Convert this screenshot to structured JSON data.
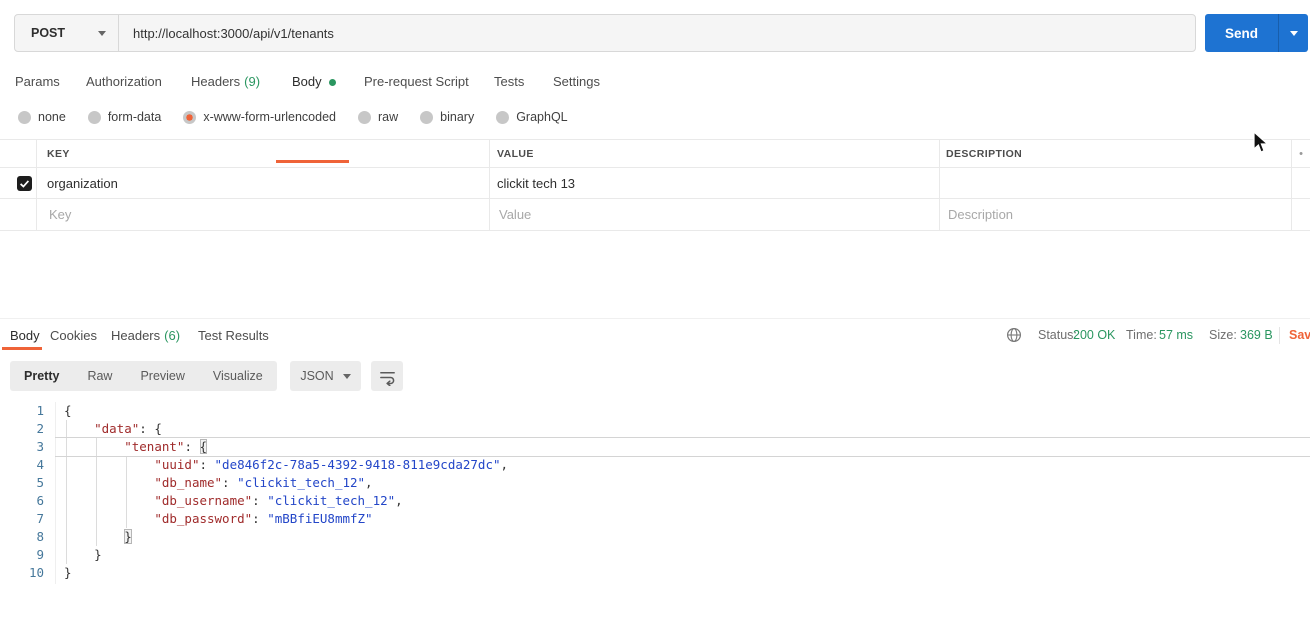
{
  "colors": {
    "accent-orange": "#ef6338",
    "send-blue": "#1e73d2",
    "success-green": "#2a9660",
    "code-key": "#a02c2c",
    "code-str": "#2346c8",
    "code-linenum": "#46789b"
  },
  "request": {
    "method": "POST",
    "url": "http://localhost:3000/api/v1/tenants",
    "send_label": "Send",
    "tabs": [
      {
        "label": "Params"
      },
      {
        "label": "Authorization"
      },
      {
        "label": "Headers",
        "count": "(9)"
      },
      {
        "label": "Body",
        "active": true
      },
      {
        "label": "Pre-request Script"
      },
      {
        "label": "Tests"
      },
      {
        "label": "Settings"
      }
    ],
    "body_modes": {
      "selected": "x-www-form-urlencoded",
      "items": [
        "none",
        "form-data",
        "x-www-form-urlencoded",
        "raw",
        "binary",
        "GraphQL"
      ]
    },
    "params_table": {
      "columns": [
        "KEY",
        "VALUE",
        "DESCRIPTION"
      ],
      "overflow_dot": "•",
      "rows": [
        {
          "checked": true,
          "key": "organization",
          "value": "clickit tech 13",
          "description": ""
        }
      ],
      "new_row": {
        "key_placeholder": "Key",
        "value_placeholder": "Value",
        "description_placeholder": "Description"
      }
    }
  },
  "response": {
    "tabs": [
      {
        "label": "Body",
        "active": true
      },
      {
        "label": "Cookies"
      },
      {
        "label": "Headers",
        "count": "(6)"
      },
      {
        "label": "Test Results"
      }
    ],
    "meta": {
      "status_label": "Status:",
      "status_value": "200 OK",
      "time_label": "Time:",
      "time_value": "57 ms",
      "size_label": "Size:",
      "size_value": "369 B",
      "save_label": "Sav"
    },
    "view_tabs": {
      "active": "Pretty",
      "items": [
        "Pretty",
        "Raw",
        "Preview",
        "Visualize"
      ]
    },
    "format": "JSON",
    "code": {
      "lines": [
        {
          "n": 1,
          "segs": [
            {
              "t": "{",
              "y": "p"
            }
          ]
        },
        {
          "n": 2,
          "segs": [
            {
              "t": "    ",
              "y": "p"
            },
            {
              "t": "\"data\"",
              "y": "k"
            },
            {
              "t": ": {",
              "y": "p"
            }
          ]
        },
        {
          "n": 3,
          "highlight": true,
          "segs": [
            {
              "t": "        ",
              "y": "p"
            },
            {
              "t": "\"tenant\"",
              "y": "k"
            },
            {
              "t": ": ",
              "y": "p"
            },
            {
              "t": "{",
              "y": "p",
              "m": true
            }
          ]
        },
        {
          "n": 4,
          "segs": [
            {
              "t": "            ",
              "y": "p"
            },
            {
              "t": "\"uuid\"",
              "y": "k"
            },
            {
              "t": ": ",
              "y": "p"
            },
            {
              "t": "\"de846f2c-78a5-4392-9418-811e9cda27dc\"",
              "y": "s"
            },
            {
              "t": ",",
              "y": "p"
            }
          ]
        },
        {
          "n": 5,
          "segs": [
            {
              "t": "            ",
              "y": "p"
            },
            {
              "t": "\"db_name\"",
              "y": "k"
            },
            {
              "t": ": ",
              "y": "p"
            },
            {
              "t": "\"clickit_tech_12\"",
              "y": "s"
            },
            {
              "t": ",",
              "y": "p"
            }
          ]
        },
        {
          "n": 6,
          "segs": [
            {
              "t": "            ",
              "y": "p"
            },
            {
              "t": "\"db_username\"",
              "y": "k"
            },
            {
              "t": ": ",
              "y": "p"
            },
            {
              "t": "\"clickit_tech_12\"",
              "y": "s"
            },
            {
              "t": ",",
              "y": "p"
            }
          ]
        },
        {
          "n": 7,
          "segs": [
            {
              "t": "            ",
              "y": "p"
            },
            {
              "t": "\"db_password\"",
              "y": "k"
            },
            {
              "t": ": ",
              "y": "p"
            },
            {
              "t": "\"mBBfiEU8mmfZ\"",
              "y": "s"
            }
          ]
        },
        {
          "n": 8,
          "segs": [
            {
              "t": "        ",
              "y": "p"
            },
            {
              "t": "}",
              "y": "p",
              "m": true
            }
          ]
        },
        {
          "n": 9,
          "segs": [
            {
              "t": "    }",
              "y": "p"
            }
          ]
        },
        {
          "n": 10,
          "segs": [
            {
              "t": "}",
              "y": "p"
            }
          ]
        }
      ]
    }
  }
}
